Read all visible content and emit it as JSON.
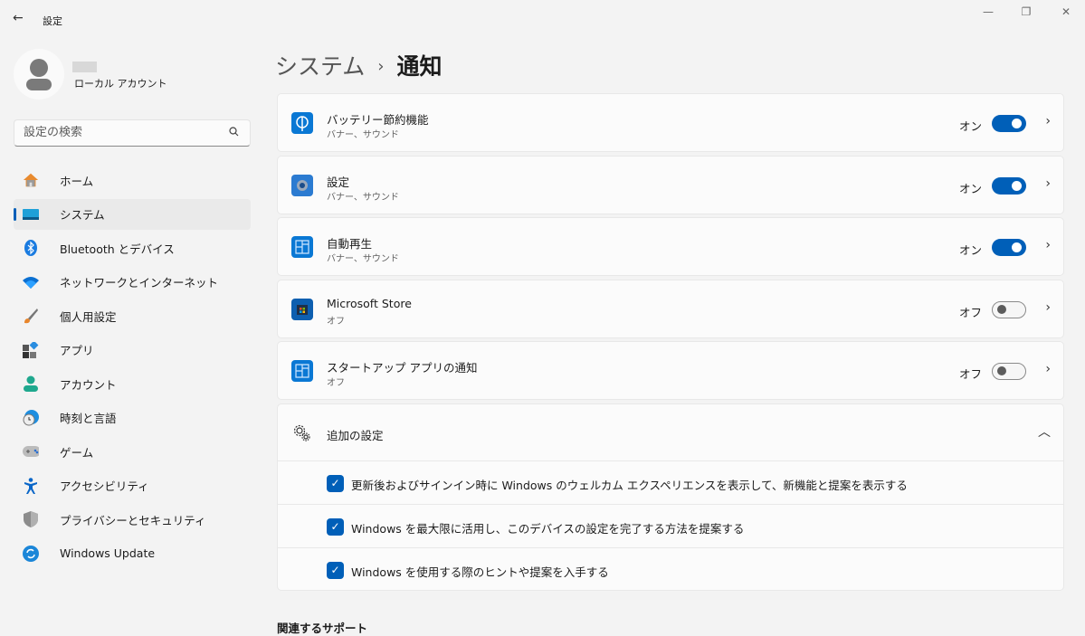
{
  "window": {
    "title": "設定",
    "back": "←",
    "minimize": "—",
    "maximize": "❐",
    "close": "✕"
  },
  "account": {
    "type": "ローカル アカウント"
  },
  "search": {
    "placeholder": "設定の検索"
  },
  "sidebar": {
    "items": [
      {
        "label": "ホーム",
        "icon": "home-icon"
      },
      {
        "label": "システム",
        "icon": "system-icon",
        "selected": true
      },
      {
        "label": "Bluetooth とデバイス",
        "icon": "bluetooth-icon"
      },
      {
        "label": "ネットワークとインターネット",
        "icon": "wifi-icon"
      },
      {
        "label": "個人用設定",
        "icon": "brush-icon"
      },
      {
        "label": "アプリ",
        "icon": "apps-icon"
      },
      {
        "label": "アカウント",
        "icon": "account-icon"
      },
      {
        "label": "時刻と言語",
        "icon": "time-language-icon"
      },
      {
        "label": "ゲーム",
        "icon": "gamepad-icon"
      },
      {
        "label": "アクセシビリティ",
        "icon": "accessibility-icon"
      },
      {
        "label": "プライバシーとセキュリティ",
        "icon": "shield-icon"
      },
      {
        "label": "Windows Update",
        "icon": "update-icon"
      }
    ]
  },
  "breadcrumb": {
    "parent": "システム",
    "separator": "›",
    "current": "通知"
  },
  "apps": [
    {
      "name": "バッテリー節約機能",
      "sub": "バナー、サウンド",
      "state": "オン",
      "on": true,
      "icon": "battery-saver-icon"
    },
    {
      "name": "設定",
      "sub": "バナー、サウンド",
      "state": "オン",
      "on": true,
      "icon": "settings-gear-icon"
    },
    {
      "name": "自動再生",
      "sub": "バナー、サウンド",
      "state": "オン",
      "on": true,
      "icon": "autoplay-icon"
    },
    {
      "name": "Microsoft Store",
      "sub": "オフ",
      "state": "オフ",
      "on": false,
      "icon": "store-icon"
    },
    {
      "name": "スタートアップ アプリの通知",
      "sub": "オフ",
      "state": "オフ",
      "on": false,
      "icon": "startup-apps-icon"
    }
  ],
  "additional": {
    "title": "追加の設定",
    "expanded": true,
    "options": [
      {
        "label": "更新後およびサインイン時に Windows のウェルカム エクスペリエンスを表示して、新機能と提案を表示する",
        "checked": true
      },
      {
        "label": "Windows を最大限に活用し、このデバイスの設定を完了する方法を提案する",
        "checked": true
      },
      {
        "label": "Windows を使用する際のヒントや提案を入手する",
        "checked": true
      }
    ]
  },
  "related": {
    "title": "関連するサポート"
  },
  "colors": {
    "accent": "#005fb8",
    "background": "#f3f3f3",
    "card": "#fbfbfb"
  }
}
